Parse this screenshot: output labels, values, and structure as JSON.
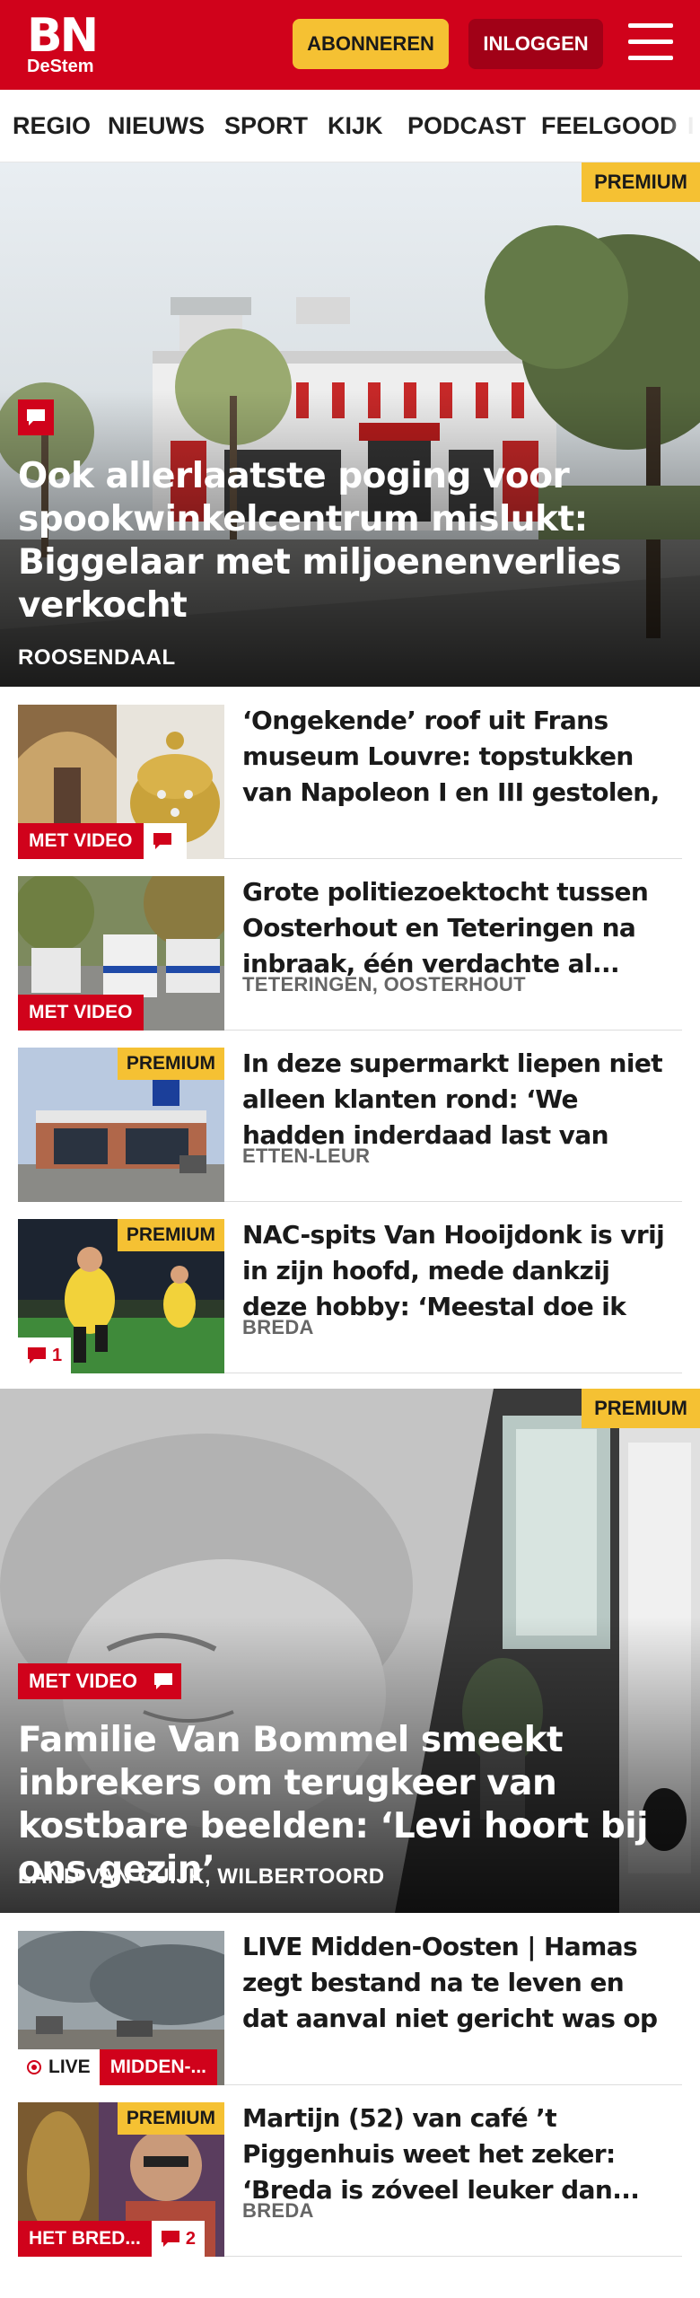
{
  "header": {
    "logo_main": "BN",
    "logo_sub": "DeStem",
    "subscribe_label": "ABONNEREN",
    "login_label": "INLOGGEN"
  },
  "nav": {
    "items": [
      "REGIO",
      "NIEUWS",
      "SPORT",
      "KIJK",
      "PODCAST",
      "FEELGOOD",
      "I"
    ]
  },
  "colors": {
    "brand_red": "#d0021b",
    "premium_yellow": "#f5c133",
    "login_dark_red": "#a10117"
  },
  "hero1": {
    "badge": "PREMIUM",
    "title": "Ook allerlaatste poging voor spookwinkelcentrum mislukt: Biggelaar met miljoenenverlies verkocht",
    "location": "ROOSENDAAL",
    "icon": "comment-icon"
  },
  "list1": [
    {
      "title": "‘Ongekende’ roof uit Frans museum Louvre: topstukken van Napoleon I en III gestolen, kroo...",
      "video_badge": "MET VIDEO",
      "icon": "comment-icon"
    },
    {
      "title": "Grote politiezoektocht tussen Oosterhout en Teteringen na inbraak, één verdachte al...",
      "location": "TETERINGEN, OOSTERHOUT",
      "video_badge": "MET VIDEO"
    },
    {
      "title": "In deze supermarkt liepen niet alleen klanten rond: ‘We hadden inderdaad last van ongedierte’",
      "location": "ETTEN-LEUR",
      "premium_badge": "PREMIUM"
    },
    {
      "title": "NAC-spits Van Hooijdonk is vrij in zijn hoofd, mede dankzij deze hobby: ‘Meestal doe ik het één...",
      "location": "BREDA",
      "premium_badge": "PREMIUM",
      "comment_count": "1"
    }
  ],
  "hero2": {
    "badge": "PREMIUM",
    "video_badge": "MET VIDEO",
    "title": "Familie Van Bommel smeekt inbrekers om terugkeer van kostbare beelden: ‘Levi hoort bij ons gezin’",
    "location": "LAND VAN CUIJK, WILBERTOORD"
  },
  "list2": [
    {
      "title": "LIVE Midden-Oosten | Hamas zegt bestand na te leven en dat aanval niet gericht was op Israël, Gaza...",
      "live_label": "LIVE",
      "tag": "MIDDEN-..."
    },
    {
      "title": "Martijn (52) van café ’t Piggenhuis weet het zeker: ‘Breda is zóveel leuker dan...",
      "location": "BREDA",
      "premium_badge": "PREMIUM",
      "tag": "HET BRED...",
      "comment_count": "2"
    }
  ]
}
